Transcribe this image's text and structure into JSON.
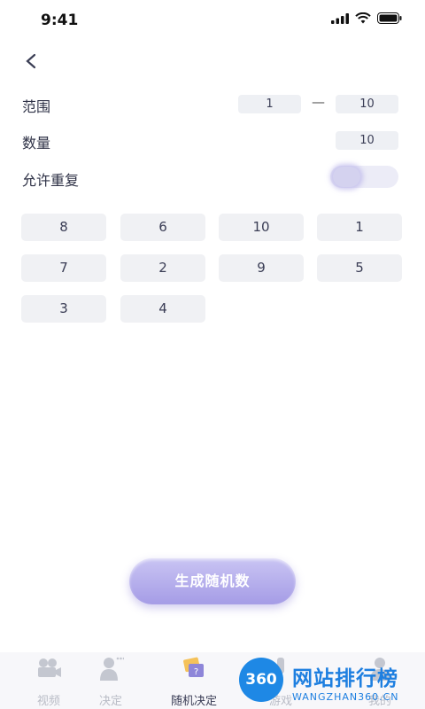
{
  "status_bar": {
    "time": "9:41"
  },
  "range": {
    "label": "范围",
    "min": "1",
    "separator": "—",
    "max": "10"
  },
  "count": {
    "label": "数量",
    "value": "10"
  },
  "repeat": {
    "label": "允许重复",
    "enabled": false
  },
  "results": [
    "8",
    "6",
    "10",
    "1",
    "7",
    "2",
    "9",
    "5",
    "3",
    "4"
  ],
  "generate_button": "生成随机数",
  "tabbar": {
    "items": [
      {
        "label": "视频",
        "icon": "video-camera-icon"
      },
      {
        "label": "决定",
        "icon": "person-thinking-icon"
      },
      {
        "label": "随机决定",
        "icon": "random-card-icon"
      },
      {
        "label": "游戏",
        "icon": "game-icon"
      },
      {
        "label": "我的",
        "icon": "profile-icon"
      }
    ],
    "active_index": 2
  },
  "watermark": {
    "badge": "360",
    "title": "网站排行榜",
    "subtitle": "WANGZHAN360.CN"
  },
  "colors": {
    "accent": "#a59ce6",
    "cell_bg": "#f0f1f4",
    "watermark": "#1e7fe0"
  }
}
